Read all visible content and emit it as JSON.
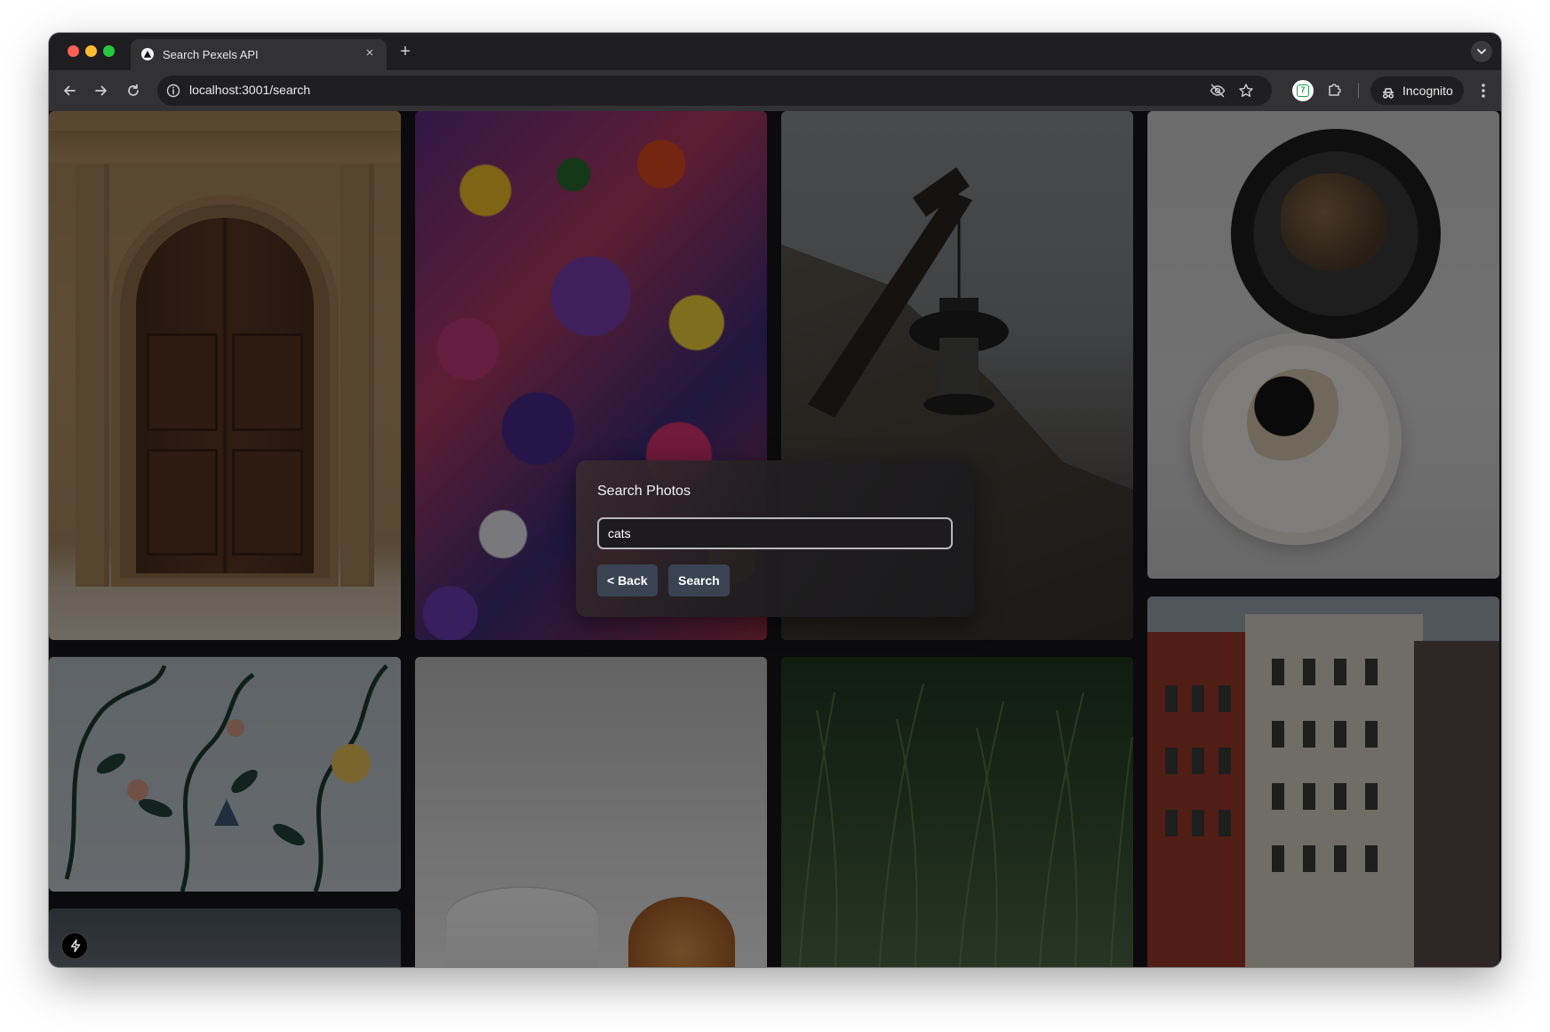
{
  "browser": {
    "tab_title": "Search Pexels API",
    "tab_close": "×",
    "new_tab": "+",
    "url": "localhost:3001/search",
    "incognito_label": "Incognito",
    "extension_badge": "7"
  },
  "modal": {
    "title": "Search Photos",
    "query": "cats",
    "back_label": "< Back",
    "search_label": "Search"
  },
  "gallery": {
    "photos": [
      {
        "subject": "arched wooden doorway"
      },
      {
        "subject": "colorful flower petals"
      },
      {
        "subject": "hanging lantern by cliff"
      },
      {
        "subject": "dessert plates on table"
      },
      {
        "subject": "botanical mural"
      },
      {
        "subject": "coffee cup and croissant"
      },
      {
        "subject": "tall green grass"
      },
      {
        "subject": "red brick city building"
      }
    ]
  },
  "icons": {
    "back": "arrow-left-icon",
    "forward": "arrow-right-icon",
    "reload": "reload-icon",
    "site_info": "info-icon",
    "eye_off": "eye-off-icon",
    "bookmark": "star-icon",
    "extensions": "puzzle-icon",
    "incognito": "incognito-icon",
    "menu": "more-vert-icon",
    "dev_tools": "lightning-icon"
  },
  "colors": {
    "page_background": "#0b0b0d",
    "button_background": "#3a4352",
    "input_border": "#b9b9bd",
    "toolbar": "#323235",
    "tabstrip": "#1e1e20"
  }
}
